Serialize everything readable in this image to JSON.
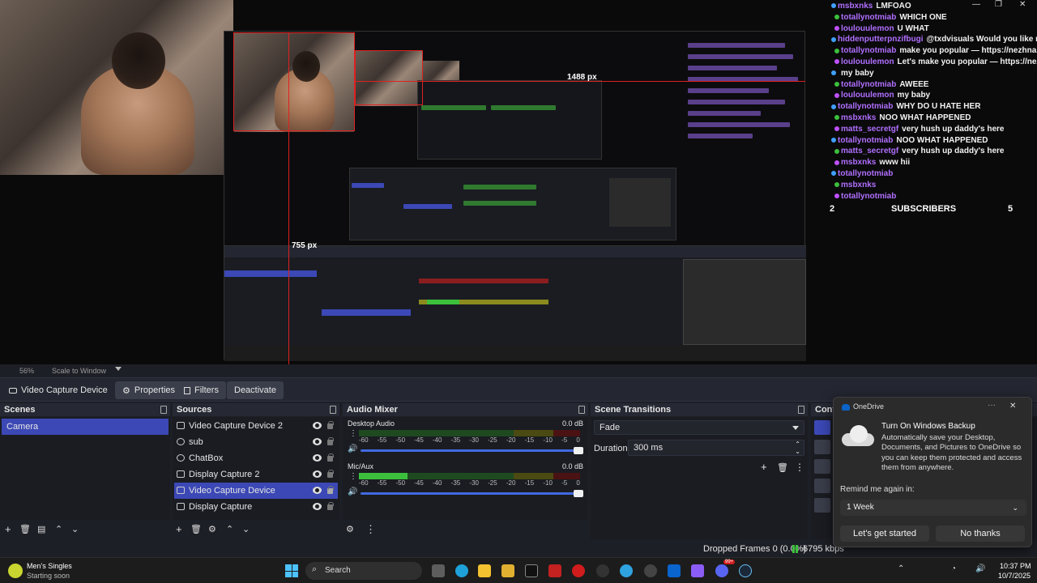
{
  "window": {
    "minimize": "—",
    "maximize": "❐",
    "close": "✕"
  },
  "preview": {
    "size_labels": [
      "1488 px",
      "755 px"
    ],
    "chat": {
      "lines": [
        {
          "user": "msbxnks",
          "msg": "LMFOAO"
        },
        {
          "user": "totallynotmiab",
          "msg": "WHICH ONE"
        },
        {
          "user": "loulouulemon",
          "msg": "U WHAT"
        },
        {
          "user": "hiddenputterpnzifbugi",
          "msg": "@txdvisuals Would you like many viewers? Let's make you popular — https://nezhna.com"
        },
        {
          "user": "totallynotmiab",
          "msg": "make you popular — https://nezhna.com"
        },
        {
          "user": "loulouulemon",
          "msg": "Let's make you popular — https://nezhna.com"
        },
        {
          "user": "",
          "msg": "my baby"
        },
        {
          "user": "totallynotmiab",
          "msg": "AWEEE"
        },
        {
          "user": "loulouulemon",
          "msg": "my baby"
        },
        {
          "user": "totallynotmiab",
          "msg": "WHY DO U HATE HER"
        },
        {
          "user": "msbxnks",
          "msg": "NOO WHAT HAPPENED"
        },
        {
          "user": "matts_secretgf",
          "msg": "very hush up daddy's here"
        },
        {
          "user": "totallynotmiab",
          "msg": "NOO WHAT HAPPENED"
        },
        {
          "user": "matts_secretgf",
          "msg": "very hush up daddy's here"
        },
        {
          "user": "msbxnks",
          "msg": "www hii"
        },
        {
          "user": "totallynotmiab",
          "msg": ""
        },
        {
          "user": "msbxnks",
          "msg": ""
        },
        {
          "user": "totallynotmiab",
          "msg": ""
        }
      ],
      "footer": {
        "left": "2",
        "center": "SUBSCRIBERS",
        "right": "5"
      }
    },
    "zoom": "56%",
    "scale_mode": "Scale to Window"
  },
  "source_bar": {
    "current_source": "Video Capture Device",
    "properties": "Properties",
    "filters": "Filters",
    "deactivate": "Deactivate"
  },
  "scenes": {
    "title": "Scenes",
    "items": [
      "Camera"
    ]
  },
  "sources": {
    "title": "Sources",
    "items": [
      "Video Capture Device 2",
      "sub",
      "ChatBox",
      "Display Capture 2",
      "Video Capture Device",
      "Display Capture"
    ]
  },
  "audio_mixer": {
    "title": "Audio Mixer",
    "channels": [
      {
        "name": "Desktop Audio",
        "db": "0.0 dB",
        "level": 0,
        "volume": 1.0
      },
      {
        "name": "Mic/Aux",
        "db": "0.0 dB",
        "level": 0.22,
        "volume": 1.0
      }
    ],
    "ticks": [
      "-60",
      "-55",
      "-50",
      "-45",
      "-40",
      "-35",
      "-30",
      "-25",
      "-20",
      "-15",
      "-10",
      "-5",
      "0"
    ]
  },
  "transitions": {
    "title": "Scene Transitions",
    "selected": "Fade",
    "duration_label": "Duration",
    "duration_value": "300 ms"
  },
  "controls": {
    "title": "Cont"
  },
  "onedrive": {
    "app": "OneDrive",
    "menu": "···",
    "close": "✕",
    "heading": "Turn On Windows Backup",
    "body": "Automatically save your Desktop, Documents, and Pictures to OneDrive so you can keep them protected and access them from anywhere.",
    "remind_label": "Remind me again in:",
    "remind_value": "1 Week",
    "primary": "Let's get started",
    "secondary": "No thanks"
  },
  "status": {
    "dropped": "Dropped Frames 0 (0.0%)",
    "bitrate": "6795 kbps"
  },
  "taskbar": {
    "media_title": "Men's Singles",
    "media_subtitle": "Starting soon",
    "search": "Search",
    "time": "10:37 PM",
    "date": "10/7/2025",
    "badge": "99+"
  },
  "colors": {
    "accent": "#3b48b5",
    "meter_green": "#3cc03c",
    "meter_yellow": "#8a8a1e",
    "meter_red": "#8a1e1e",
    "slider": "#4169e1"
  }
}
